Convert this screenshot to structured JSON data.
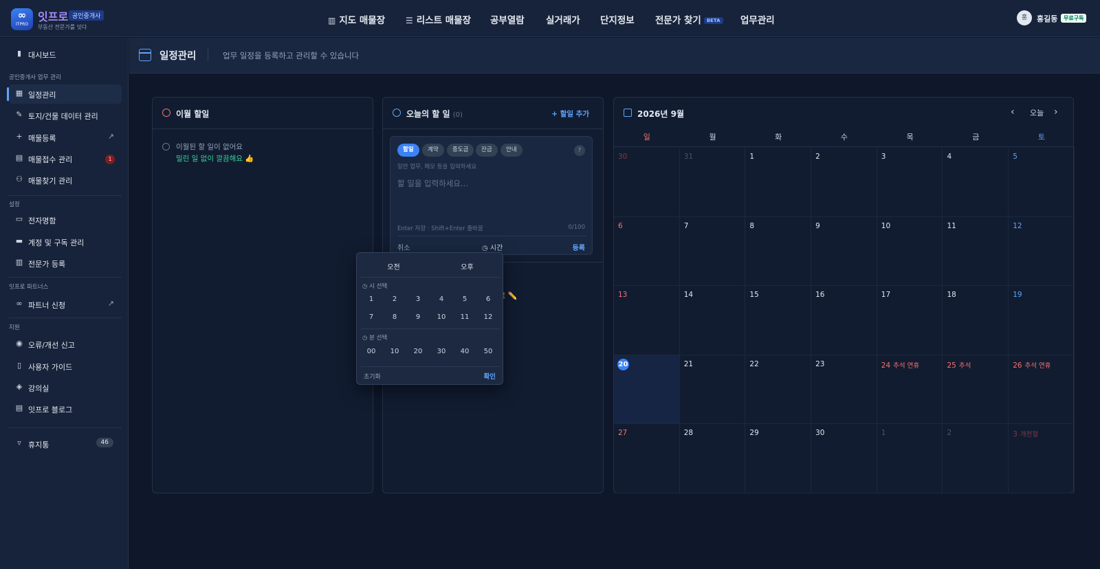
{
  "brand": {
    "logo_text": "ITPRO",
    "name": "잇프로",
    "badge": "공인중개사",
    "tagline": "부동산 전문가를 잇다"
  },
  "nav": [
    {
      "label": "지도 매물장",
      "icon": "map-icon"
    },
    {
      "label": "리스트 매물장",
      "icon": "list-icon"
    },
    {
      "label": "공부열람"
    },
    {
      "label": "실거래가"
    },
    {
      "label": "단지정보"
    },
    {
      "label": "전문가 찾기",
      "badge": "BETA"
    },
    {
      "label": "업무관리"
    }
  ],
  "user": {
    "avatar": "홍",
    "name": "홍길동",
    "plan": "무료구독"
  },
  "sidebar": {
    "dashboard": "대시보드",
    "section_work": "공인중개사 업무 관리",
    "schedule": "일정관리",
    "land_data": "토지/건물 데이터 관리",
    "register": "매물등록",
    "intake": "매물접수 관리",
    "intake_badge": "1",
    "search_mgmt": "매물찾기 관리",
    "section_settings": "설정",
    "ecard": "전자명함",
    "account": "계정 및 구독 관리",
    "expert_reg": "전문가 등록",
    "section_partners": "잇프로 파트너스",
    "partner": "파트너 신청",
    "section_support": "지원",
    "report": "오류/개선 신고",
    "guide": "사용자 가이드",
    "class": "강의실",
    "blog": "잇프로 블로그",
    "trash": "휴지통",
    "trash_count": "46"
  },
  "header": {
    "title": "일정관리",
    "subtitle": "업무 일정을 등록하고 관리할 수 있습니다"
  },
  "monthly": {
    "title": "이월 할일",
    "empty": "이월된 할 일이 없어요",
    "empty_sub": "밀린 일 없이 깔끔해요 👍"
  },
  "today_todo": {
    "title": "오늘의 할 일",
    "count": "(0)",
    "add": "+ 할일 추가",
    "chips": [
      "할일",
      "계약",
      "중도금",
      "잔금",
      "안내"
    ],
    "help": "?",
    "hint": "일반 업무, 메모 등을 입력하세요",
    "placeholder": "할 일을 입력하세요...",
    "shortcut": "Enter 저장 · Shift+Enter 줄바꿈",
    "counter": "0/100",
    "cancel": "취소",
    "time": "시간",
    "save": "등록",
    "partial": "료 ✏️"
  },
  "calendar": {
    "title": "2026년 9월",
    "today_btn": "오늘",
    "weekdays": [
      "일",
      "월",
      "화",
      "수",
      "목",
      "금",
      "토"
    ],
    "weeks": [
      [
        {
          "d": "30",
          "t": "mutedred"
        },
        {
          "d": "31",
          "t": "muted"
        },
        {
          "d": "1"
        },
        {
          "d": "2"
        },
        {
          "d": "3"
        },
        {
          "d": "4"
        },
        {
          "d": "5",
          "t": "blue"
        }
      ],
      [
        {
          "d": "6",
          "t": "red"
        },
        {
          "d": "7"
        },
        {
          "d": "8"
        },
        {
          "d": "9"
        },
        {
          "d": "10"
        },
        {
          "d": "11"
        },
        {
          "d": "12",
          "t": "blue"
        }
      ],
      [
        {
          "d": "13",
          "t": "red"
        },
        {
          "d": "14"
        },
        {
          "d": "15"
        },
        {
          "d": "16"
        },
        {
          "d": "17"
        },
        {
          "d": "18"
        },
        {
          "d": "19",
          "t": "blue"
        }
      ],
      [
        {
          "d": "20",
          "today": true
        },
        {
          "d": "21"
        },
        {
          "d": "22"
        },
        {
          "d": "23"
        },
        {
          "d": "24",
          "t": "red",
          "ev": "추석 연휴"
        },
        {
          "d": "25",
          "t": "red",
          "ev": "추석"
        },
        {
          "d": "26",
          "t": "red",
          "ev": "추석 연휴"
        }
      ],
      [
        {
          "d": "27",
          "t": "red"
        },
        {
          "d": "28"
        },
        {
          "d": "29"
        },
        {
          "d": "30"
        },
        {
          "d": "1",
          "t": "muted"
        },
        {
          "d": "2",
          "t": "muted"
        },
        {
          "d": "3",
          "t": "mutedred",
          "ev": "개천절"
        }
      ]
    ]
  },
  "time_picker": {
    "am": "오전",
    "pm": "오후",
    "hour_label": "시 선택",
    "hours": [
      "1",
      "2",
      "3",
      "4",
      "5",
      "6",
      "7",
      "8",
      "9",
      "10",
      "11",
      "12"
    ],
    "minute_label": "분 선택",
    "minutes": [
      "00",
      "10",
      "20",
      "30",
      "40",
      "50"
    ],
    "reset": "초기화",
    "confirm": "확인"
  }
}
